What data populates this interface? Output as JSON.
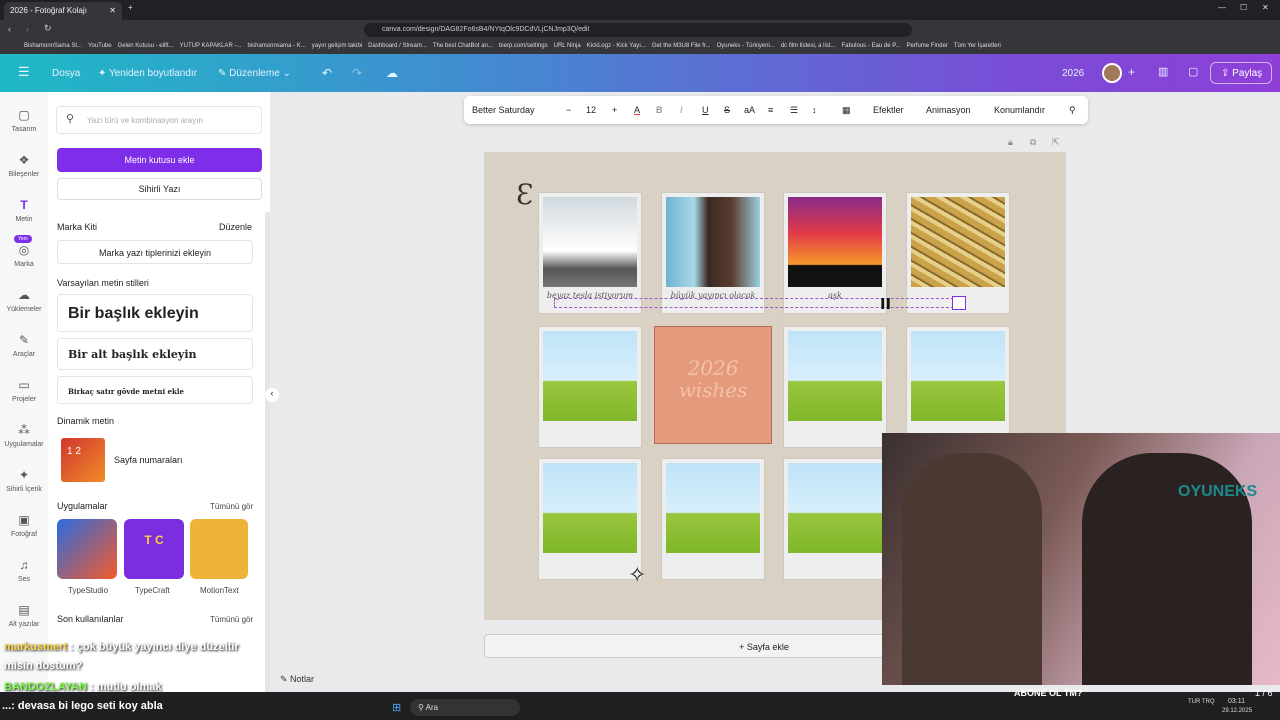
{
  "browser": {
    "tab_title": "2026 - Fotoğraf Kolajı",
    "url": "canva.com/design/DAG82Fo6sB4/NYtqOlc9DCdVLjCNJmp3Q/edit",
    "bookmarks": [
      "BishamonnSama St...",
      "YouTube",
      "Gelen Kutusu - elift...",
      "YUTUP KAPAKLAR -...",
      "bishamonnsama - K...",
      "yayın gelişim takibi",
      "Dashboard / Stream...",
      "The best ChatBot an...",
      "bierp.com/settings",
      "URL Ninja",
      "KickLogz - Kick Yayı...",
      "Get the M3U8 File fr...",
      "Oyuneks - Türkiyeni...",
      "dc film listesi, a list...",
      "Fabulous - Eau de P...",
      "Perfume Finder",
      "Tüm Yer İşaretleri"
    ]
  },
  "header": {
    "file": "Dosya",
    "resize": "Yeniden boyutlandır",
    "edit": "Düzenleme",
    "title": "2026",
    "share": "Paylaş"
  },
  "rail": [
    {
      "icon": "layout-icon",
      "label": "Tasarım"
    },
    {
      "icon": "elements-icon",
      "label": "Bileşenler"
    },
    {
      "icon": "text-icon",
      "label": "Metin"
    },
    {
      "icon": "brand-icon",
      "label": "Marka",
      "badge": "Yeni"
    },
    {
      "icon": "upload-icon",
      "label": "Yüklemeler"
    },
    {
      "icon": "tools-icon",
      "label": "Araçlar"
    },
    {
      "icon": "projects-icon",
      "label": "Projeler"
    },
    {
      "icon": "apps-icon",
      "label": "Uygulamalar"
    },
    {
      "icon": "magic-icon",
      "label": "Sihirli İçerik"
    },
    {
      "icon": "photo-icon",
      "label": "Fotoğraf"
    },
    {
      "icon": "audio-icon",
      "label": "Ses"
    },
    {
      "icon": "caption-icon",
      "label": "Alt yazılar"
    }
  ],
  "panel": {
    "search_placeholder": "Yazı türü ve kombinasyon arayın",
    "add_textbox": "Metin kutusu ekle",
    "magic_write": "Sihirli Yazı",
    "brand_kit": "Marka Kiti",
    "brand_edit": "Düzenle",
    "brand_add": "Marka yazı tiplerinizi ekleyin",
    "default_styles": "Varsayılan metin stilleri",
    "heading": "Bir başlık ekleyin",
    "subheading": "Bir alt başlık ekleyin",
    "body": "Birkaç satır gövde metni ekle",
    "dynamic": "Dinamik metin",
    "page_numbers": "Sayfa numaraları",
    "apps": "Uygulamalar",
    "see_all": "Tümünü gör",
    "app_list": [
      "TypeStudio",
      "TypeCraft",
      "MotionText"
    ],
    "recent": "Son kullanılanlar",
    "recent_all": "Tümünü gör"
  },
  "toolbar": {
    "font": "Better Saturday",
    "size": "12",
    "effects": "Efektler",
    "animation": "Animasyon",
    "position": "Konumlandır"
  },
  "page": {
    "captions": [
      "beyaz tesla istiyorum",
      "büyük yayıncı olacak",
      "aşk",
      ""
    ],
    "postit": "2026 wishes"
  },
  "footer": {
    "add_page": "+ Sayfa ekle",
    "notes": "Notlar",
    "page_count": "1 / 6"
  },
  "chat": [
    {
      "user": "markusmert",
      "msg": "çok büyük yayıncı diye düzeltir misin dostum?"
    },
    {
      "user": "BANDOZLAYAN",
      "msg": "mutlu olmak"
    }
  ],
  "ticker": "...: devasa bi lego seti koy abla",
  "webcam": {
    "watermark": "OYUNEKS",
    "banner": "ABONE OL TM?"
  },
  "taskbar": {
    "search": "Ara",
    "time": "03:11",
    "date": "29.12.2025",
    "lang": "TUR TRQ"
  }
}
